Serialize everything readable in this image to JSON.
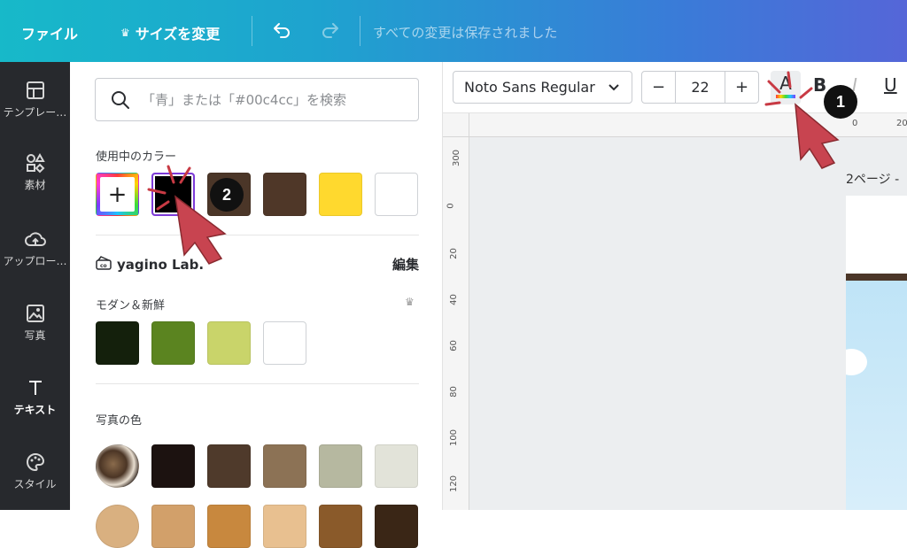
{
  "topbar": {
    "file_label": "ファイル",
    "resize_label": "サイズを変更",
    "status": "すべての変更は保存されました"
  },
  "leftnav": {
    "items": [
      {
        "label": "テンプレー…",
        "icon": "template-icon"
      },
      {
        "label": "素材",
        "icon": "elements-icon"
      },
      {
        "label": "アップロー…",
        "icon": "upload-icon"
      },
      {
        "label": "写真",
        "icon": "photo-icon"
      },
      {
        "label": "テキスト",
        "icon": "text-icon"
      },
      {
        "label": "スタイル",
        "icon": "style-icon"
      }
    ]
  },
  "panel": {
    "search_placeholder": "「青」または「#00c4cc」を検索",
    "in_use_title": "使用中のカラー",
    "in_use_colors": [
      "#000000",
      "#4b3628",
      "#4f3728",
      "#ffd92e",
      "#ffffff"
    ],
    "brand_name": "yagino Lab.",
    "edit_label": "編集",
    "palette_title": "モダン＆新鮮",
    "palette_colors": [
      "#14200c",
      "#5b8420",
      "#c9d46a",
      "#ffffff"
    ],
    "photo_title": "写真の色",
    "photo_colors": [
      "#1c1210",
      "#4f3a2b",
      "#8c7255",
      "#b6b8a0",
      "#e2e3d9"
    ],
    "photo_colors_row2": [
      "#d2a06a",
      "#c8883e",
      "#e8c090",
      "#8a5a2a",
      "#3a2616"
    ]
  },
  "toolbar": {
    "font_name": "Noto Sans Regular",
    "font_size": "22",
    "minus": "−",
    "plus": "+",
    "text_color_letter": "A",
    "bold": "B",
    "italic": "I",
    "underline": "U"
  },
  "canvas": {
    "page_label": "2ページ -",
    "ruler_left": [
      "300",
      "0",
      "20",
      "40",
      "60",
      "80",
      "100",
      "120"
    ],
    "ruler_top": [
      "0",
      "20"
    ]
  },
  "annotations": {
    "badge1": "1",
    "badge2": "2",
    "accent_color": "#c83a44"
  }
}
